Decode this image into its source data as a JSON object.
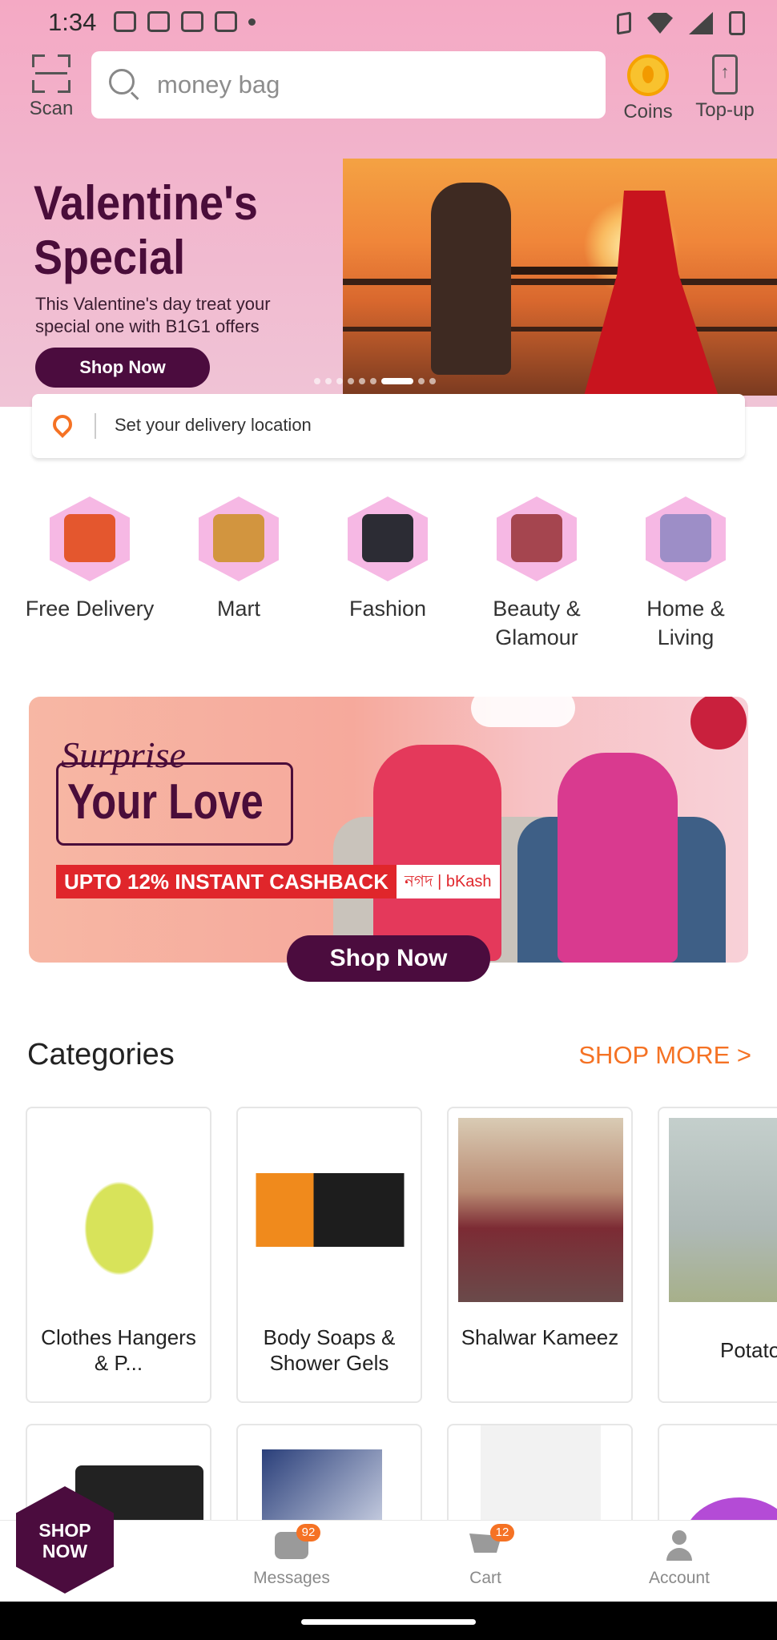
{
  "status_bar": {
    "time": "1:34"
  },
  "header": {
    "scan_label": "Scan",
    "search_placeholder": "money bag",
    "coins_label": "Coins",
    "topup_label": "Top-up"
  },
  "hero": {
    "title": "Valentine's Special",
    "subtitle": "This Valentine's day treat your special one with B1G1 offers",
    "cta": "Shop Now"
  },
  "delivery": {
    "placeholder": "Set your delivery location"
  },
  "quick_categories": [
    {
      "label": "Free Delivery"
    },
    {
      "label": "Mart"
    },
    {
      "label": "Fashion"
    },
    {
      "label": "Beauty & Glamour"
    },
    {
      "label": "Home & Living"
    }
  ],
  "promo": {
    "title_line1": "Surprise",
    "title_line2": "Your Love",
    "cashback": "UPTO 12% INSTANT CASHBACK",
    "payment_partners": "নগদ | bKash",
    "cta": "Shop Now"
  },
  "categories": {
    "title": "Categories",
    "shop_more": "SHOP MORE >",
    "items": [
      {
        "name": "Clothes Hangers & P..."
      },
      {
        "name": "Body Soaps & Shower Gels"
      },
      {
        "name": "Shalwar Kameez"
      },
      {
        "name": "Potato"
      }
    ]
  },
  "floating_cta": {
    "label": "SHOP NOW"
  },
  "bottom_nav": {
    "messages": {
      "label": "Messages",
      "badge": "92"
    },
    "cart": {
      "label": "Cart",
      "badge": "12"
    },
    "account": {
      "label": "Account"
    }
  },
  "colors": {
    "accent": "#f57224",
    "brand_dark": "#4b0c3e",
    "header_pink": "#f4a9c4"
  }
}
